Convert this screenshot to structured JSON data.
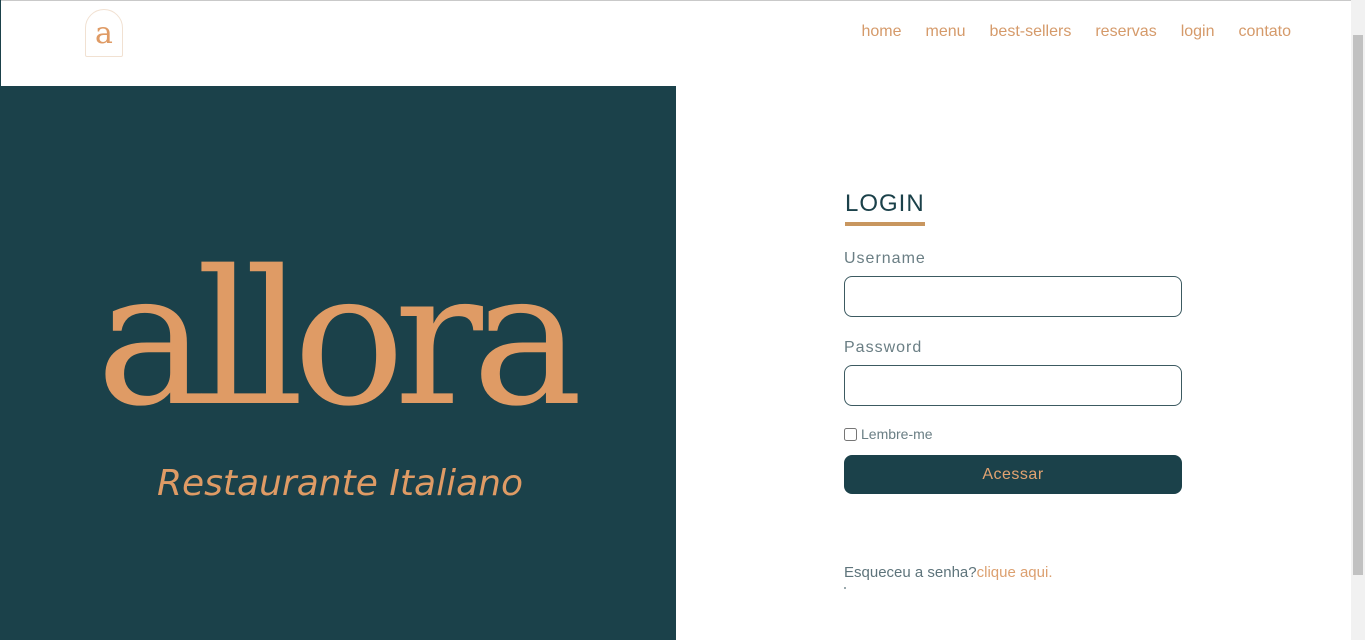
{
  "header": {
    "logo_letter": "a",
    "nav": [
      {
        "label": "home"
      },
      {
        "label": "menu"
      },
      {
        "label": "best-sellers"
      },
      {
        "label": "reservas"
      },
      {
        "label": "login"
      },
      {
        "label": "contato"
      }
    ]
  },
  "hero": {
    "brand": "allora",
    "tagline": "Restaurante Italiano"
  },
  "login": {
    "title": "LOGIN",
    "username_label": "Username",
    "username_value": "",
    "password_label": "Password",
    "password_value": "",
    "remember_label": "Lembre-me",
    "remember_checked": false,
    "submit_label": "Acessar",
    "forgot_text": "Esqueceu a senha?",
    "forgot_link": "clique aqui."
  },
  "colors": {
    "primary": "#1b414a",
    "accent": "#df9b65",
    "text_muted": "#6a7e84"
  }
}
